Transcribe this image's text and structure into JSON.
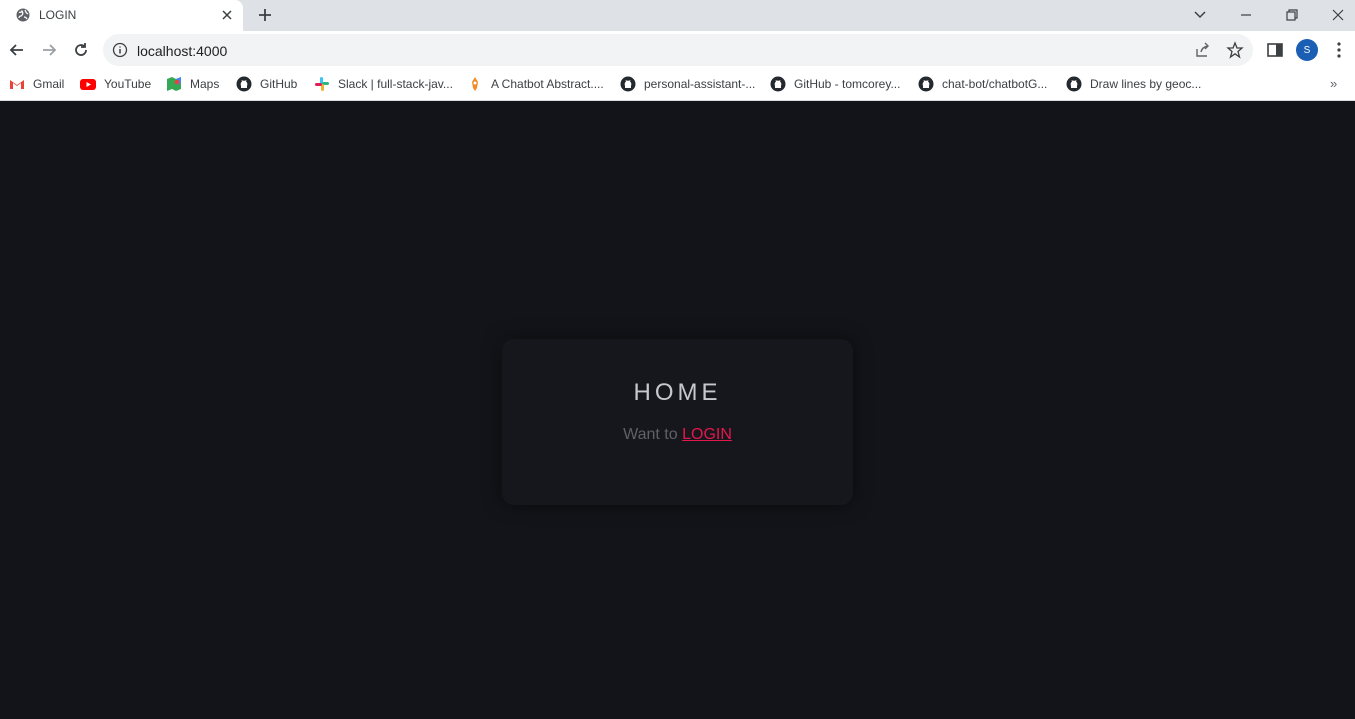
{
  "browser": {
    "tab_title": "LOGIN",
    "url": "localhost:4000",
    "avatar_initial": "S"
  },
  "bookmarks": [
    {
      "label": "Gmail",
      "icon": "gmail-icon"
    },
    {
      "label": "YouTube",
      "icon": "youtube-icon"
    },
    {
      "label": "Maps",
      "icon": "maps-icon"
    },
    {
      "label": "GitHub",
      "icon": "github-icon"
    },
    {
      "label": "Slack | full-stack-jav...",
      "icon": "slack-icon"
    },
    {
      "label": "A Chatbot Abstract....",
      "icon": "chatbot-icon"
    },
    {
      "label": "personal-assistant-...",
      "icon": "github-icon"
    },
    {
      "label": "GitHub - tomcorey...",
      "icon": "github-icon"
    },
    {
      "label": "chat-bot/chatbotG...",
      "icon": "github-icon"
    },
    {
      "label": "Draw lines by geoc...",
      "icon": "github-icon"
    }
  ],
  "page": {
    "title": "HOME",
    "prompt_text": "Want to ",
    "login_link": "LOGIN"
  },
  "colors": {
    "background": "#131419",
    "card": "#16171c",
    "accent": "#e3174d",
    "title_text": "#c8c8cc",
    "muted_text": "#5f6068"
  }
}
